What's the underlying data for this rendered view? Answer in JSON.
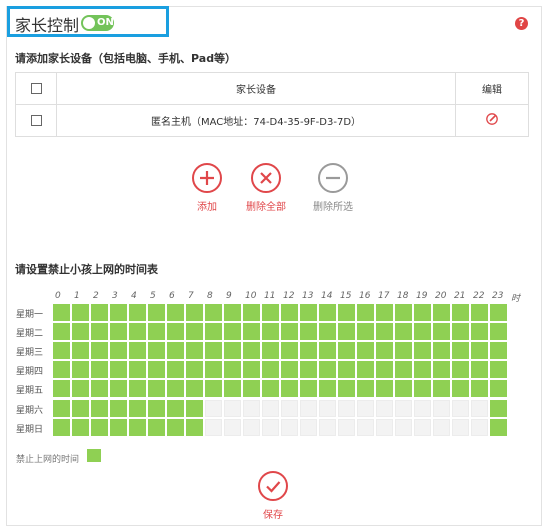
{
  "header": {
    "title": "家长控制",
    "toggle_label": "ON",
    "help_label": "?"
  },
  "devices": {
    "section_title": "请添加家长设备（包括电脑、手机、Pad等）",
    "columns": [
      "家长设备",
      "编辑"
    ],
    "rows": [
      {
        "name": "匿名主机（MAC地址：74-D4-35-9F-D3-7D）"
      }
    ]
  },
  "actions": {
    "add": "添加",
    "delete_all": "删除全部",
    "delete_selected": "删除所选"
  },
  "schedule": {
    "section_title": "请设置禁止小孩上网的时间表",
    "hours": [
      "0",
      "1",
      "2",
      "3",
      "4",
      "5",
      "6",
      "7",
      "8",
      "9",
      "10",
      "11",
      "12",
      "13",
      "14",
      "15",
      "16",
      "17",
      "18",
      "19",
      "20",
      "21",
      "22",
      "23",
      "时"
    ],
    "days": [
      "星期一",
      "星期二",
      "星期三",
      "星期四",
      "星期五",
      "星期六",
      "星期日"
    ],
    "blocked": [
      [
        0,
        1,
        2,
        3,
        4,
        5,
        6,
        7,
        8,
        9,
        10,
        11,
        12,
        13,
        14,
        15,
        16,
        17,
        18,
        19,
        20,
        21,
        22,
        23
      ],
      [
        0,
        1,
        2,
        3,
        4,
        5,
        6,
        7,
        8,
        9,
        10,
        11,
        12,
        13,
        14,
        15,
        16,
        17,
        18,
        19,
        20,
        21,
        22,
        23
      ],
      [
        0,
        1,
        2,
        3,
        4,
        5,
        6,
        7,
        8,
        9,
        10,
        11,
        12,
        13,
        14,
        15,
        16,
        17,
        18,
        19,
        20,
        21,
        22,
        23
      ],
      [
        0,
        1,
        2,
        3,
        4,
        5,
        6,
        7,
        8,
        9,
        10,
        11,
        12,
        13,
        14,
        15,
        16,
        17,
        18,
        19,
        20,
        21,
        22,
        23
      ],
      [
        0,
        1,
        2,
        3,
        4,
        5,
        6,
        7,
        8,
        9,
        10,
        11,
        12,
        13,
        14,
        15,
        16,
        17,
        18,
        19,
        20,
        21,
        22,
        23
      ],
      [
        0,
        1,
        2,
        3,
        4,
        5,
        6,
        7,
        23
      ],
      [
        0,
        1,
        2,
        3,
        4,
        5,
        6,
        7,
        23
      ]
    ],
    "legend_label": "禁止上网的时间"
  },
  "save_label": "保存",
  "colors": {
    "accent": "#1a9fe0",
    "blocked": "#8fd053",
    "danger": "#e0474a",
    "toggle_on": "#73c35a"
  }
}
